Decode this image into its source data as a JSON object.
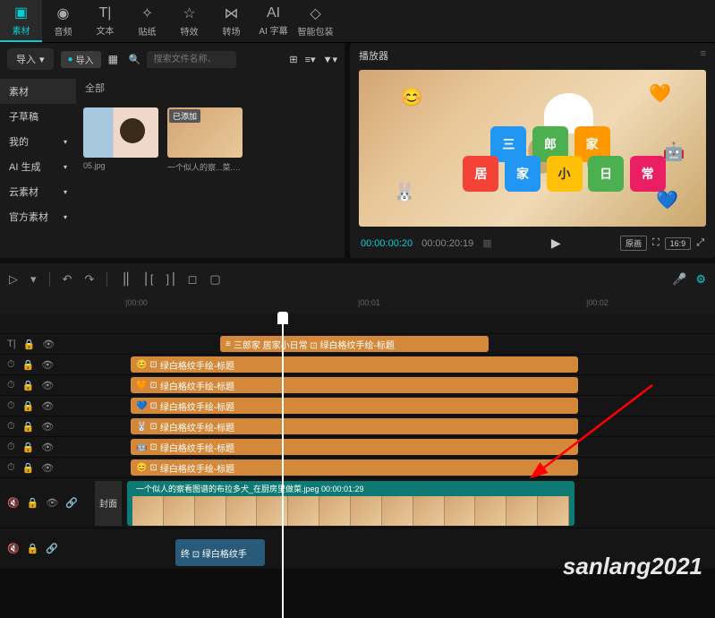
{
  "toolbar": [
    {
      "icon": "▣",
      "label": "素材",
      "active": true
    },
    {
      "icon": "◉",
      "label": "音频"
    },
    {
      "icon": "T|",
      "label": "文本"
    },
    {
      "icon": "✧",
      "label": "贴纸"
    },
    {
      "icon": "☆",
      "label": "特效"
    },
    {
      "icon": "⋈",
      "label": "转场"
    },
    {
      "icon": "AI",
      "label": "AI 字幕"
    },
    {
      "icon": "◇",
      "label": "智能包装"
    }
  ],
  "import": {
    "btn": "导入",
    "btn2": "导入"
  },
  "search": {
    "placeholder": "搜索文件名称、"
  },
  "sidebar": {
    "all": "全部",
    "items": [
      {
        "label": "素材",
        "active": true
      },
      {
        "label": "子草稿"
      },
      {
        "label": "我的",
        "arrow": true
      },
      {
        "label": "AI 生成",
        "arrow": true
      },
      {
        "label": "云素材",
        "arrow": true
      },
      {
        "label": "官方素材",
        "arrow": true
      }
    ]
  },
  "media": [
    {
      "name": "05.jpg",
      "tag": ""
    },
    {
      "name": "一个似人的察...菜.jpeg",
      "tag": "已添加"
    }
  ],
  "player": {
    "title": "播放器",
    "current": "00:00:00:20",
    "total": "00:00:20:19",
    "ratio1": "原画",
    "ratio2": "16:9",
    "badges": [
      "三",
      "郎",
      "家",
      "居",
      "家",
      "小",
      "日",
      "常"
    ]
  },
  "ruler": {
    "marks": [
      "|00:00",
      "|00:01",
      "|00:02"
    ]
  },
  "tracks": {
    "title_clip": "三郎家 居家小日常 ⊡ 绿白格纹手绘-标题",
    "orange_label": "绿白格纹手绘-标题",
    "video_label": "一个似人的察看图谱的布拉多犬_在厨房里做菜.jpeg  00:00:01:29",
    "cover": "封面",
    "audio_label": "终 ⊡ 绿白格纹手"
  },
  "watermark": "sanlang2021"
}
